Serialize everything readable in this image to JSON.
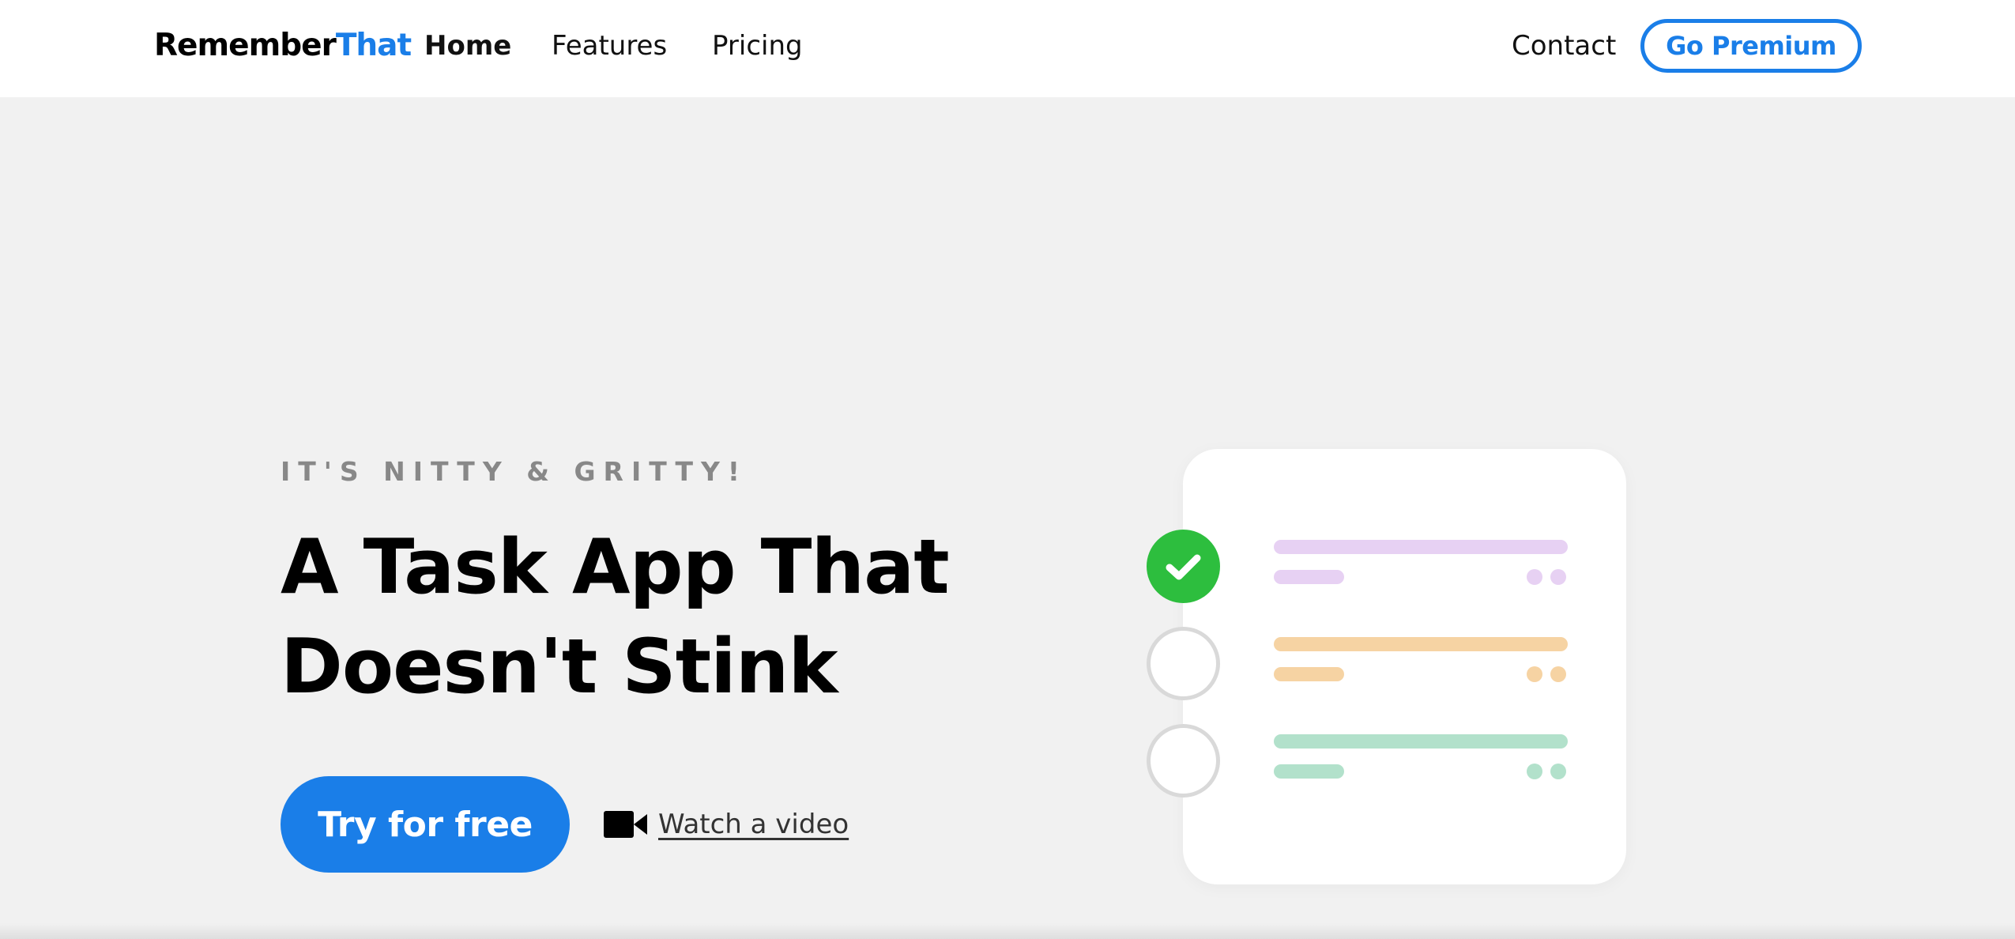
{
  "navbar": {
    "logo_part1": "Remember",
    "logo_part2": "That",
    "links": {
      "home": "Home",
      "features": "Features",
      "pricing": "Pricing",
      "contact": "Contact"
    },
    "premium_button": "Go Premium"
  },
  "hero": {
    "eyebrow": "IT'S NITTY & GRITTY!",
    "headline_line1": "A Task App That",
    "headline_line2": "Doesn't Stink",
    "cta_button": "Try for free",
    "video_link": "Watch a video",
    "video_icon": "video-camera-icon"
  },
  "illustration": {
    "tasks": [
      {
        "status": "done",
        "color": "#e7d1f3"
      },
      {
        "status": "todo",
        "color": "#f6d3a3"
      },
      {
        "status": "todo",
        "color": "#b2e1cb"
      }
    ],
    "check_color": "#2dbe3e"
  },
  "colors": {
    "brand_blue": "#1a7ee8",
    "background": "#f1f1f1",
    "eyebrow_gray": "#888888"
  }
}
